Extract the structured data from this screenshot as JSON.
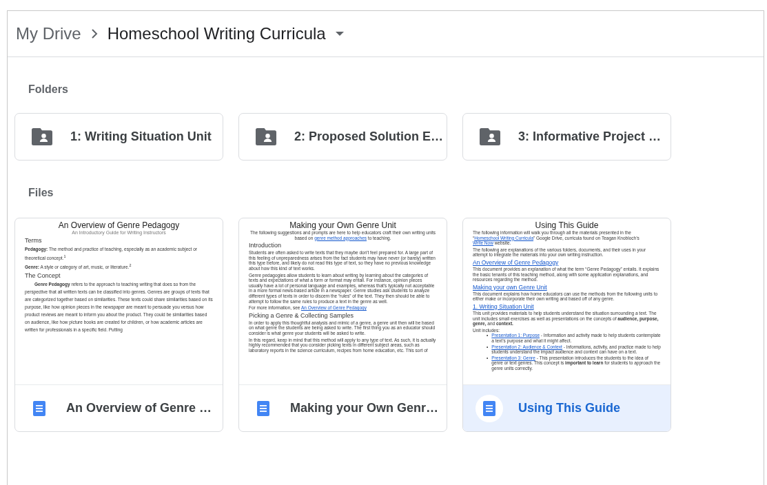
{
  "breadcrumb": {
    "parent": "My Drive",
    "current": "Homeschool Writing Curricula"
  },
  "folders": {
    "heading": "Folders",
    "items": [
      {
        "name": "1: Writing Situation Unit"
      },
      {
        "name": "2: Proposed Solution E…"
      },
      {
        "name": "3: Informative Project …"
      }
    ]
  },
  "files": {
    "heading": "Files",
    "items": [
      {
        "name": "An Overview of Genre …",
        "selected": false,
        "double_spaced": true,
        "preview": [
          {
            "kind": "title",
            "text": "An Overview of Genre Pedagogy"
          },
          {
            "kind": "subtitle",
            "text": "An Introductory Guide for Writing Instructors"
          },
          {
            "kind": "heading",
            "text": "Terms"
          },
          {
            "kind": "para",
            "text": "**Pedagogy:** The method and practice of teaching, especially as an academic subject or theoretical concept.$^{1}$"
          },
          {
            "kind": "para",
            "text": "**Genre:** A style or category of art, music, or literature.$^{2}$"
          },
          {
            "kind": "heading",
            "text": "The Concept"
          },
          {
            "kind": "indented_para",
            "text": "**Genre Pedagogy** refers to the approach to teaching writing that does so from the perspective that all written texts can be classified into genres. Genres are groups of texts that are categorized together based on similarities. These texts could share similarities based on its purpose, like how opinion pieces in the newspaper are meant to persuade you versus how product reviews are meant to inform you about the product. They could be similarities based on audience, like how picture books are created for children, or how academic articles are written for professionals in a specific field. Putting"
          }
        ]
      },
      {
        "name": "Making your Own Genr…",
        "selected": false,
        "double_spaced": false,
        "preview": [
          {
            "kind": "title",
            "text": "Making your Own Genre Unit"
          },
          {
            "kind": "centered_para",
            "parts": [
              {
                "kind": "text",
                "text": "The following suggestions and prompts are here to help educators craft their own writing units based on "
              },
              {
                "kind": "link",
                "text": "genre method approaches"
              },
              {
                "kind": "text",
                "text": " to teaching."
              }
            ]
          },
          {
            "kind": "heading",
            "text": "Introduction"
          },
          {
            "kind": "para",
            "text": "Students are often asked to write texts that they maybe don't feel prepared for. A large part of this feeling of unpreparedness arises from the fact students may have never (or barely) written this type before, and likely do not read this type of text, so they have no previous knowledge about how this kind of text works."
          },
          {
            "kind": "para",
            "text": "Genre pedagogies allow students to learn about writing by learning about the categories of texts and expectations of what a form or format may entail. For instance, opinion pieces usually have a lot of personal language and examples, whereas that's typically not acceptable in a more formal news-based article in a newspaper. Genre studies ask students to analyze different types of texts in order to discern the “rules” of the text. They then should be able to attempt to follow the same rules to produce a text in the genre as well."
          },
          {
            "kind": "para",
            "parts": [
              {
                "kind": "text",
                "text": "For more information, see "
              },
              {
                "kind": "link",
                "text": "An Overview of Genre Pedagogy"
              }
            ]
          },
          {
            "kind": "heading",
            "text": "Picking a Genre & Collecting Samples"
          },
          {
            "kind": "para",
            "text": "In order to apply this thoughtful analysis and mimic of a genre, a genre unit then will be based on what genre the students are being asked to write. The first thing you as an educator should consider is what genre your students will be asked to write."
          },
          {
            "kind": "para",
            "text": "In this regard, keep in mind that this method will apply to any type of text. As such, it is actually highly recommended that you consider picking texts in different subject areas, such as laboratory reports in the science curriculum, recipes from home education, etc. This sort of"
          }
        ]
      },
      {
        "name": "Using This Guide",
        "selected": true,
        "double_spaced": false,
        "preview": [
          {
            "kind": "title",
            "text": "Using This Guide"
          },
          {
            "kind": "para",
            "parts": [
              {
                "kind": "text",
                "text": "The following information will walk you through all the materials presented in the “"
              },
              {
                "kind": "link",
                "text": "Homeschool Writing Curricula"
              },
              {
                "kind": "text",
                "text": "” Google Drive, curricula found on Teagan Knobloch’s "
              },
              {
                "kind": "link",
                "text": "Write Now"
              },
              {
                "kind": "text",
                "text": " website."
              }
            ]
          },
          {
            "kind": "para",
            "text": "The following are explanations of the various folders, documents, and their uses in your attempt to integrate the materials into your own writing instruction."
          },
          {
            "kind": "link_heading",
            "text": "An Overview of Genre Pedagogy"
          },
          {
            "kind": "para",
            "text": "This document provides an explanation of what the term “Genre Pedagogy” entails. It explains the basic tenants of this teaching method, along with some application explanations, and resources regarding the method."
          },
          {
            "kind": "link_heading",
            "text": "Making your own Genre Unit"
          },
          {
            "kind": "para",
            "text": "This document explains how home educators can use the methods from the following units to either make or incorporate their own writing and based off of any genre."
          },
          {
            "kind": "link_heading",
            "text": "1. Writing Situation Unit"
          },
          {
            "kind": "para",
            "text": "This unit provides materials to help students understand the situation surrounding a text. The unit includes small exercises as well as presentations on the concepts of **audience, purpose, genre,** and **context.**"
          },
          {
            "kind": "tight_para",
            "text": "Unit includes:"
          },
          {
            "kind": "bullet",
            "marker": "•",
            "parts": [
              {
                "kind": "link",
                "text": "Presentation 1: Purpose"
              },
              {
                "kind": "text",
                "text": " - Information and activity made to help students contemplate a text’s purpose and what it might affect."
              }
            ]
          },
          {
            "kind": "bullet",
            "marker": "•",
            "parts": [
              {
                "kind": "link",
                "text": "Presentation 2: Audience & Context"
              },
              {
                "kind": "text",
                "text": " - Informations, activity, and practice made to help students understand the impact audience and context can have on a text."
              }
            ]
          },
          {
            "kind": "bullet",
            "marker": "•",
            "parts": [
              {
                "kind": "link",
                "text": "Presentation 3: Genre"
              },
              {
                "kind": "text",
                "text": " - This presentation introduces the students to the idea of genre or text genres. This concept is **important to learn** for students to approach the genre units correctly."
              }
            ]
          }
        ]
      }
    ]
  }
}
